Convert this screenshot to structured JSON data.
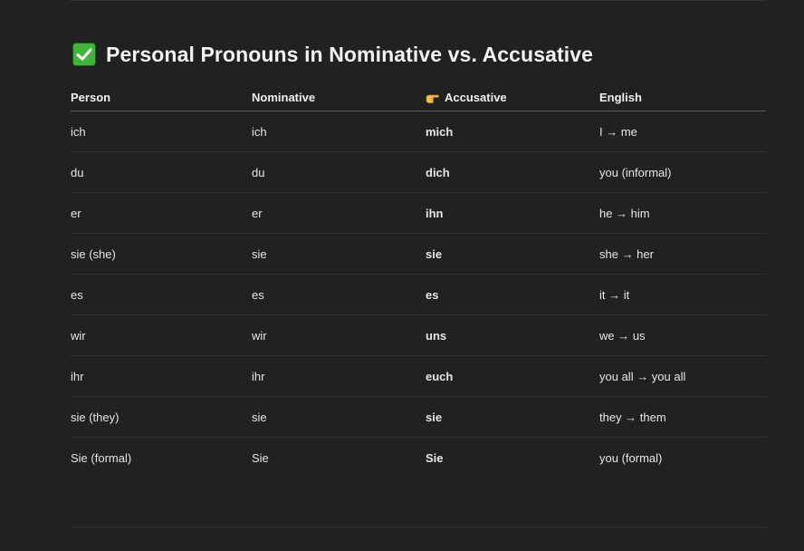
{
  "heading": {
    "icon": "check-mark-button-icon",
    "title": "Personal Pronouns in Nominative vs. Accusative"
  },
  "table": {
    "headers": {
      "person": "Person",
      "nominative": "Nominative",
      "accusative_icon": "pointing-hand-icon",
      "accusative": "Accusative",
      "english": "English"
    },
    "rows": [
      {
        "person": "ich",
        "nominative": "ich",
        "accusative": "mich",
        "english": "I → me"
      },
      {
        "person": "du",
        "nominative": "du",
        "accusative": "dich",
        "english": "you (informal)"
      },
      {
        "person": "er",
        "nominative": "er",
        "accusative": "ihn",
        "english": "he → him"
      },
      {
        "person": "sie (she)",
        "nominative": "sie",
        "accusative": "sie",
        "english": "she → her"
      },
      {
        "person": "es",
        "nominative": "es",
        "accusative": "es",
        "english": "it → it"
      },
      {
        "person": "wir",
        "nominative": "wir",
        "accusative": "uns",
        "english": "we → us"
      },
      {
        "person": "ihr",
        "nominative": "ihr",
        "accusative": "euch",
        "english": "you all → you all"
      },
      {
        "person": "sie (they)",
        "nominative": "sie",
        "accusative": "sie",
        "english": "they → them"
      },
      {
        "person": "Sie (formal)",
        "nominative": "Sie",
        "accusative": "Sie",
        "english": "you (formal)"
      }
    ]
  },
  "colors": {
    "background": "#212121",
    "check_green": "#3fb63b",
    "hand_yellow": "#f7c34a"
  }
}
